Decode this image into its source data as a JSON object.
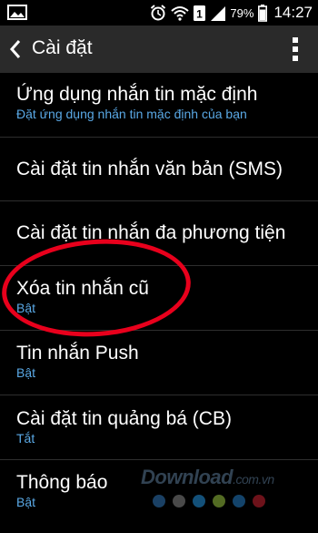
{
  "status_bar": {
    "battery_percent": "79%",
    "time": "14:27",
    "icons": [
      "image-icon",
      "alarm-icon",
      "wifi-icon",
      "sim-1-icon",
      "signal-icon",
      "battery-icon"
    ]
  },
  "action_bar": {
    "title": "Cài đặt",
    "back_icon": "chevron-left-icon",
    "menu_icon": "more-vertical-icon"
  },
  "settings": [
    {
      "label": "Ứng dụng nhắn tin mặc định",
      "sub": "Đặt ứng dụng nhắn tin mặc định của bạn"
    },
    {
      "label": "Cài đặt tin nhắn văn bản (SMS)",
      "sub": ""
    },
    {
      "label": "Cài đặt tin nhắn đa phương tiện",
      "sub": ""
    },
    {
      "label": "Xóa tin nhắn cũ",
      "sub": "Bật"
    },
    {
      "label": "Tin nhắn Push",
      "sub": "Bật"
    },
    {
      "label": "Cài đặt tin quảng bá (CB)",
      "sub": "Tắt"
    },
    {
      "label": "Thông báo",
      "sub": "Bật"
    }
  ],
  "watermark": {
    "brand": "Download",
    "domain": ".com.vn"
  },
  "colors": {
    "accent": "#5aa9e6",
    "action_bar": "#2a2a2a",
    "highlight": "#e8001c",
    "watermark_dots": [
      "#2c6aa6",
      "#7a7a7a",
      "#1f86c9",
      "#8bb33a",
      "#1f6fb0",
      "#b51e2c"
    ]
  }
}
